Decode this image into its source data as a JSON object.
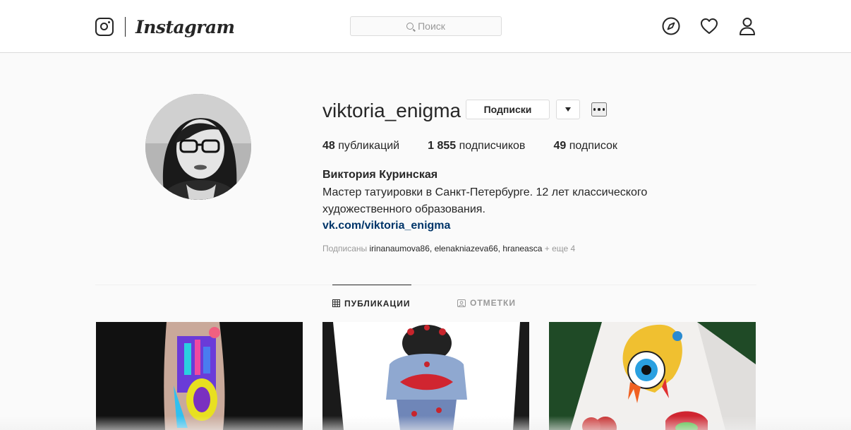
{
  "header": {
    "logo_text": "Instagram",
    "search_placeholder": "Поиск",
    "nav_icons": [
      "explore-compass-icon",
      "activity-heart-icon",
      "profile-person-icon"
    ]
  },
  "profile": {
    "username": "viktoria_enigma",
    "follow_button_label": "Подписки",
    "stats": {
      "posts_count": "48",
      "posts_label": "публикаций",
      "followers_count": "1 855",
      "followers_label": "подписчиков",
      "following_count": "49",
      "following_label": "подписок"
    },
    "full_name": "Виктория Куринская",
    "bio": "Мастер татуировки в Санкт-Петербурге. 12 лет классического художественного образования.",
    "website": "vk.com/viktoria_enigma",
    "followed_by": {
      "prefix": "Подписаны",
      "users": [
        "irinanaumova86",
        "elenakniazeva66",
        "hraneasca"
      ],
      "more": "+ еще 4"
    }
  },
  "tabs": [
    {
      "label": "ПУБЛИКАЦИИ",
      "active": true
    },
    {
      "label": "ОТМЕТКИ",
      "active": false
    }
  ],
  "colors": {
    "link": "#003569",
    "text": "#262626",
    "muted": "#999999",
    "border": "#dbdbdb",
    "background": "#fafafa"
  }
}
